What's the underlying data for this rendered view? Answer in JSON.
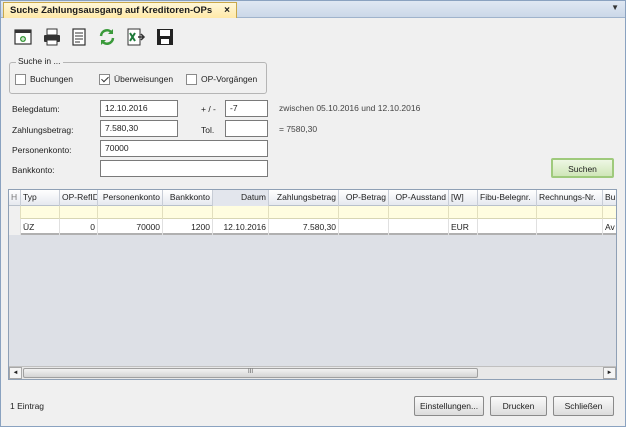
{
  "window": {
    "tab_title": "Suche Zahlungsausgang auf Kreditoren-OPs",
    "tab_close": "×",
    "tab_menu": "▼"
  },
  "toolbar": {
    "icons": [
      "new-window-icon",
      "print-icon",
      "document-icon",
      "refresh-icon",
      "excel-export-icon",
      "save-icon"
    ]
  },
  "search_in": {
    "title": "Suche in ...",
    "options": [
      {
        "label": "Buchungen",
        "checked": false
      },
      {
        "label": "Überweisungen",
        "checked": true
      },
      {
        "label": "OP-Vorgängen",
        "checked": false
      }
    ]
  },
  "form": {
    "belegdatum_label": "Belegdatum:",
    "belegdatum_value": "12.10.2016",
    "tolerance_days_label": "+ / -",
    "tolerance_days_value": "-7",
    "date_range_text": "zwischen 05.10.2016 und 12.10.2016",
    "zahlungsbetrag_label": "Zahlungsbetrag:",
    "zahlungsbetrag_value": "7.580,30",
    "tol_label": "Tol.",
    "tol_value": "",
    "amount_text": "= 7580,30",
    "personenkonto_label": "Personenkonto:",
    "personenkonto_value": "70000",
    "bankkonto_label": "Bankkonto:",
    "bankkonto_value": "",
    "search_button": "Suchen"
  },
  "grid": {
    "row_header": "H",
    "columns": [
      "Typ",
      "OP-RefID",
      "Personenkonto",
      "Bankkonto",
      "Datum",
      "Zahlungsbetrag",
      "OP-Betrag",
      "OP-Ausstand",
      "[W]",
      "Fibu-Belegnr.",
      "Rechnungs-Nr.",
      "Bu"
    ],
    "rows": [
      [
        "ÜZ",
        "0",
        "70000",
        "1200",
        "12.10.2016",
        "7.580,30",
        "",
        "",
        "EUR",
        "",
        "",
        "Av"
      ]
    ],
    "scroll_thumb": "III",
    "scroll_left": "◄",
    "scroll_right": "►"
  },
  "footer": {
    "status": "1 Eintrag",
    "settings_button": "Einstellungen...",
    "print_button": "Drucken",
    "close_button": "Schließen"
  }
}
